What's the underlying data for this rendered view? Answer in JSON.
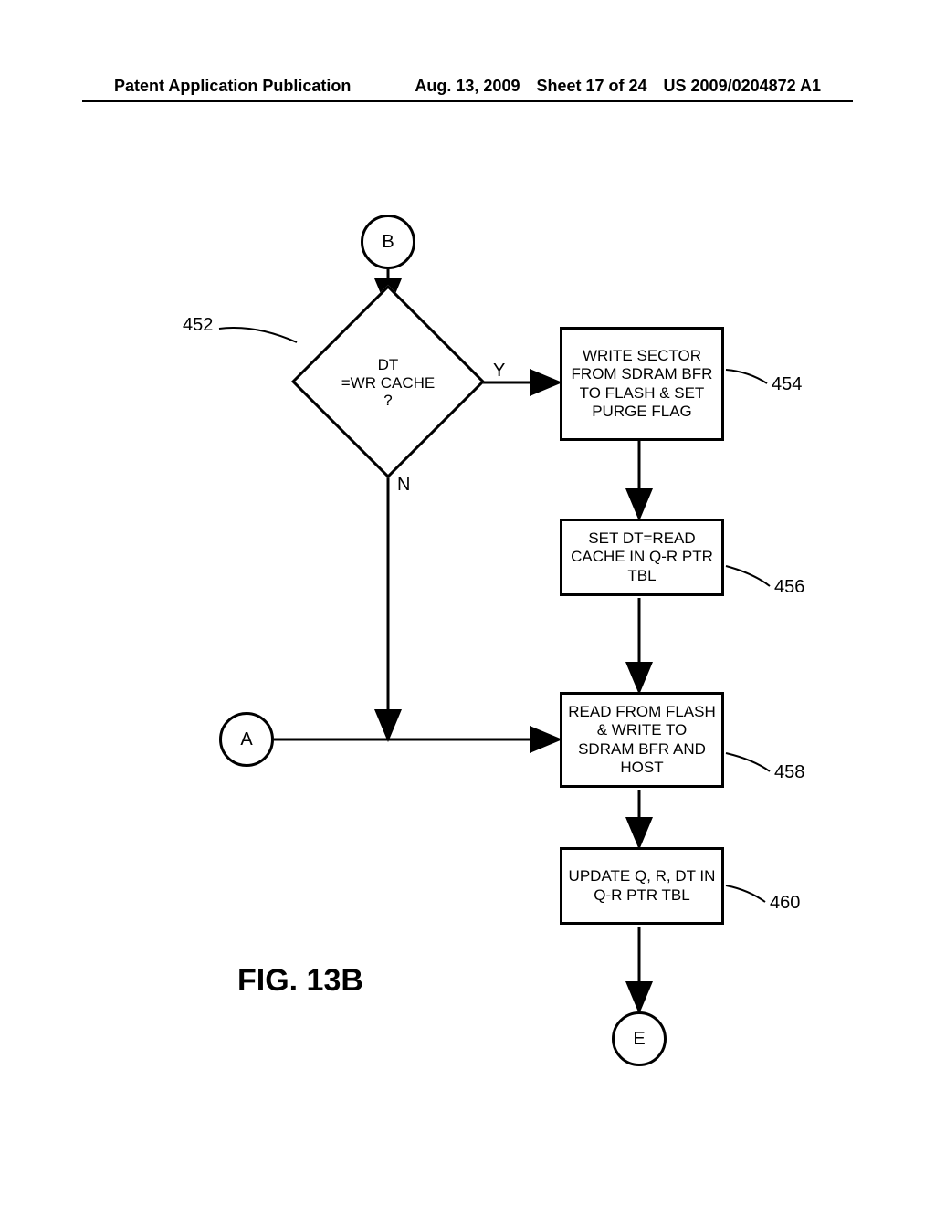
{
  "header": {
    "left": "Patent Application Publication",
    "date": "Aug. 13, 2009",
    "sheet": "Sheet 17 of 24",
    "pub_number": "US 2009/0204872 A1"
  },
  "connectors": {
    "B": "B",
    "A": "A",
    "E": "E"
  },
  "decision": {
    "text": "DT\n=WR CACHE\n?",
    "ref": "452",
    "yes": "Y",
    "no": "N"
  },
  "boxes": {
    "b454": {
      "text": "WRITE SECTOR FROM SDRAM BFR TO FLASH & SET PURGE FLAG",
      "ref": "454"
    },
    "b456": {
      "text": "SET DT=READ CACHE IN Q-R PTR TBL",
      "ref": "456"
    },
    "b458": {
      "text": "READ FROM FLASH & WRITE TO SDRAM BFR AND HOST",
      "ref": "458"
    },
    "b460": {
      "text": "UPDATE Q, R, DT IN Q-R PTR TBL",
      "ref": "460"
    }
  },
  "figure_label": "FIG. 13B"
}
